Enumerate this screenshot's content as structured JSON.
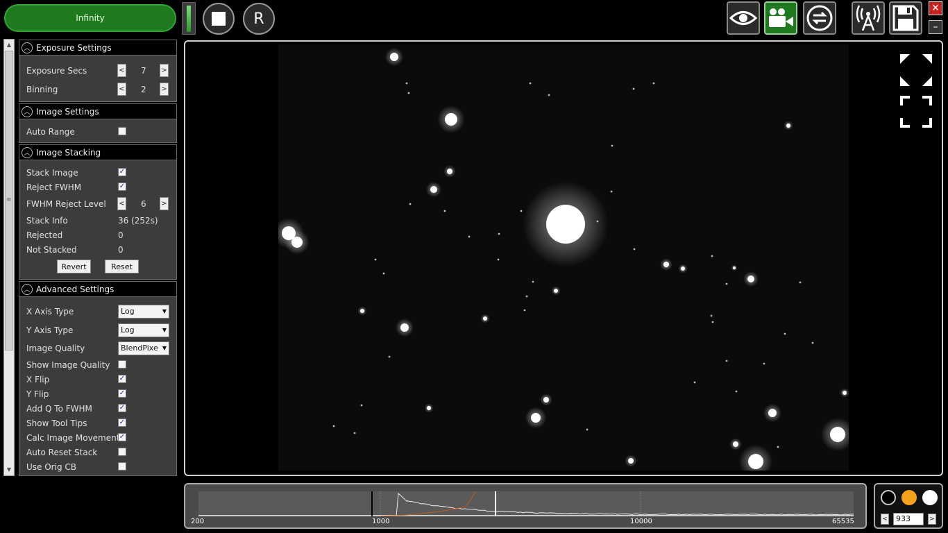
{
  "toolbar": {
    "duration_label": "Infinity",
    "reset_label": "R"
  },
  "icons": {
    "stop": "stop-icon",
    "eye": "eye-icon",
    "camera": "video-camera-icon",
    "loop": "loop-icon",
    "antenna": "antenna-icon",
    "save": "save-icon",
    "close": "close-icon",
    "minimize": "minimize-icon"
  },
  "window": {
    "close_label": "✕",
    "min_label": "–"
  },
  "colors": {
    "accent_green": "#1f7a1f",
    "orange": "#f5a21a"
  },
  "exposure": {
    "header": "Exposure Settings",
    "exposure_label": "Exposure Secs",
    "exposure_value": "7",
    "binning_label": "Binning",
    "binning_value": "2"
  },
  "image_settings": {
    "header": "Image Settings",
    "auto_range_label": "Auto Range",
    "auto_range": false
  },
  "stacking": {
    "header": "Image Stacking",
    "stack_image_label": "Stack Image",
    "stack_image": true,
    "reject_fwhm_label": "Reject FWHM",
    "reject_fwhm": true,
    "fwhm_level_label": "FWHM Reject Level",
    "fwhm_level_value": "6",
    "stack_info_label": "Stack Info",
    "stack_info_value": "36 (252s)",
    "rejected_label": "Rejected",
    "rejected_value": "0",
    "not_stacked_label": "Not Stacked",
    "not_stacked_value": "0",
    "revert_label": "Revert",
    "reset_label": "Reset"
  },
  "advanced": {
    "header": "Advanced Settings",
    "x_axis_label": "X Axis Type",
    "x_axis_value": "Log",
    "y_axis_label": "Y Axis Type",
    "y_axis_value": "Log",
    "quality_label": "Image Quality",
    "quality_value": "BlendPixe",
    "show_quality_label": "Show Image Quality",
    "show_quality": false,
    "x_flip_label": "X Flip",
    "x_flip": true,
    "y_flip_label": "Y Flip",
    "y_flip": true,
    "add_q_label": "Add Q To FWHM",
    "add_q": true,
    "tooltips_label": "Show Tool Tips",
    "tooltips": true,
    "calc_move_label": "Calc Image Movement",
    "calc_move": true,
    "auto_reset_label": "Auto Reset Stack",
    "auto_reset": false,
    "orig_cb_label": "Use Orig CB",
    "orig_cb": false
  },
  "histogram": {
    "labels": [
      "200",
      "1000",
      "10000",
      "65535"
    ],
    "black_point": 1000,
    "white_point": 2500
  },
  "color_panel": {
    "value": "933",
    "prev": "<",
    "next": ">"
  }
}
